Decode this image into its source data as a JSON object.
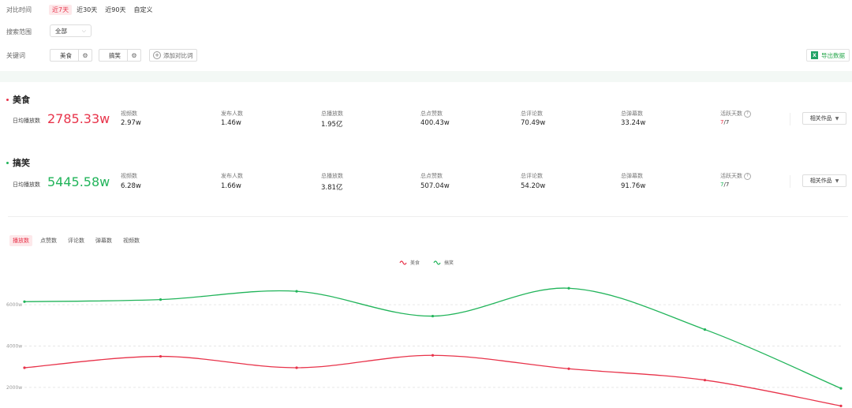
{
  "filters": {
    "time_label": "对比时间",
    "time_options": [
      "近7天",
      "近30天",
      "近90天",
      "自定义"
    ],
    "time_active": 0,
    "scope_label": "搜索范围",
    "scope_value": "全部",
    "keyword_label": "关键词",
    "keywords": [
      "美食",
      "搞笑"
    ],
    "add_keyword": "添加对比词",
    "export": "导出数据"
  },
  "keywords": [
    {
      "name": "美食",
      "color": "#e8334a",
      "avg_label": "日均播放数",
      "avg_value": "2785.33w",
      "metrics": [
        {
          "label": "视频数",
          "value": "2.97w"
        },
        {
          "label": "发布人数",
          "value": "1.46w"
        },
        {
          "label": "总播放数",
          "value": "1.95亿"
        },
        {
          "label": "总点赞数",
          "value": "400.43w"
        },
        {
          "label": "总评论数",
          "value": "70.49w"
        },
        {
          "label": "总弹幕数",
          "value": "33.24w"
        }
      ],
      "active_label": "活跃天数",
      "active_value": "7",
      "active_total": "/7",
      "related": "相关作品"
    },
    {
      "name": "搞笑",
      "color": "#21b45a",
      "avg_label": "日均播放数",
      "avg_value": "5445.58w",
      "metrics": [
        {
          "label": "视频数",
          "value": "6.28w"
        },
        {
          "label": "发布人数",
          "value": "1.66w"
        },
        {
          "label": "总播放数",
          "value": "3.81亿"
        },
        {
          "label": "总点赞数",
          "value": "507.04w"
        },
        {
          "label": "总评论数",
          "value": "54.20w"
        },
        {
          "label": "总弹幕数",
          "value": "91.76w"
        }
      ],
      "active_label": "活跃天数",
      "active_value": "7",
      "active_total": "/7",
      "related": "相关作品"
    }
  ],
  "tabs": [
    "播放数",
    "点赞数",
    "评论数",
    "弹幕数",
    "视频数"
  ],
  "active_tab": 0,
  "chart_data": {
    "type": "line",
    "smooth": true,
    "yticks": [
      "2000w",
      "4000w",
      "6000w"
    ],
    "ytick_values": [
      2000,
      4000,
      6000
    ],
    "ylim": [
      1000,
      7000
    ],
    "grid": true,
    "legend_position": "top-center",
    "x_count": 7,
    "series": [
      {
        "name": "美食",
        "color": "#e8334a",
        "values": [
          2950,
          3500,
          2950,
          3550,
          2900,
          2350,
          1100
        ]
      },
      {
        "name": "搞笑",
        "color": "#21b45a",
        "values": [
          6150,
          6250,
          6650,
          5450,
          6800,
          4800,
          1950
        ]
      }
    ]
  }
}
